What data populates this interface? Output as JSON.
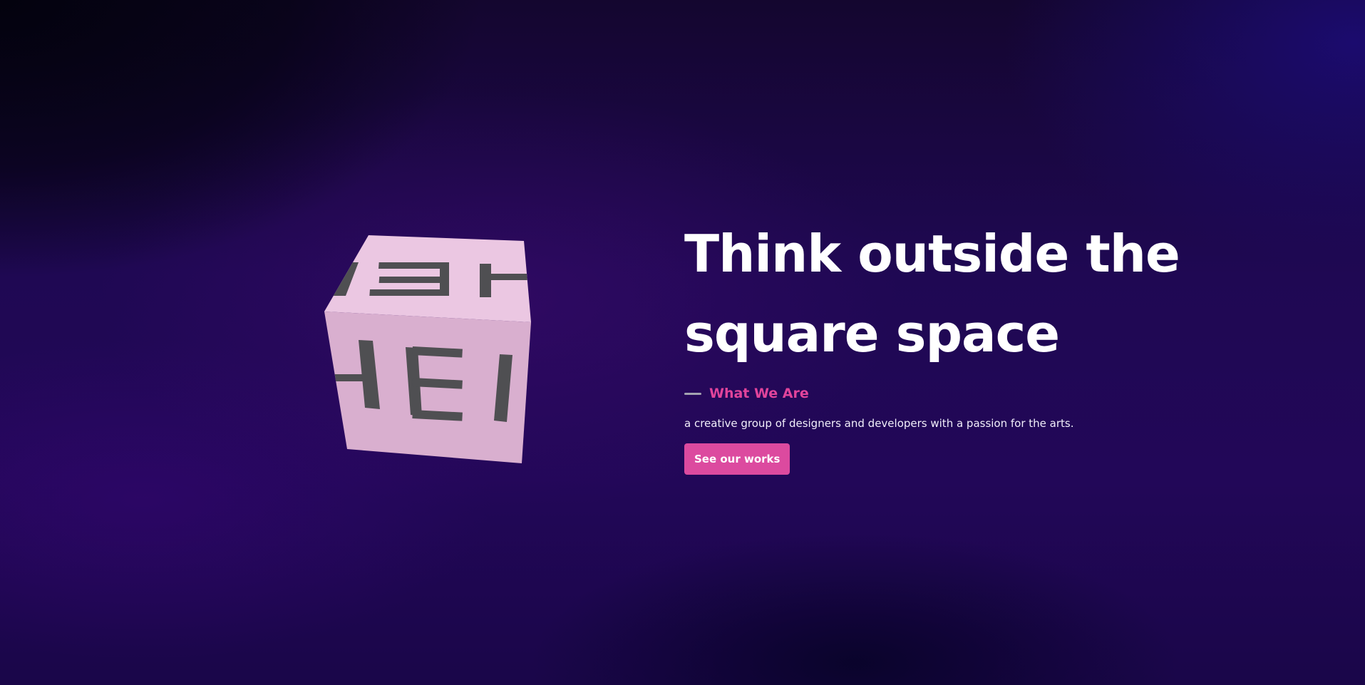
{
  "hero": {
    "title_line1": "Think outside the",
    "title_line2": "square space",
    "eyebrow": "What We Are",
    "tagline": "a creative group of designers and developers with a passion for the arts.",
    "cta_label": "See our works"
  },
  "cube": {
    "face_text": "HELLO",
    "face_color": "#d9afcf",
    "top_color": "#ebc7e2",
    "letter_color": "#4f4f52"
  },
  "colors": {
    "accent": "#dc4a9f",
    "eyebrow": "#e1449b",
    "background_dark": "#14062f",
    "background_purple": "#220758"
  }
}
